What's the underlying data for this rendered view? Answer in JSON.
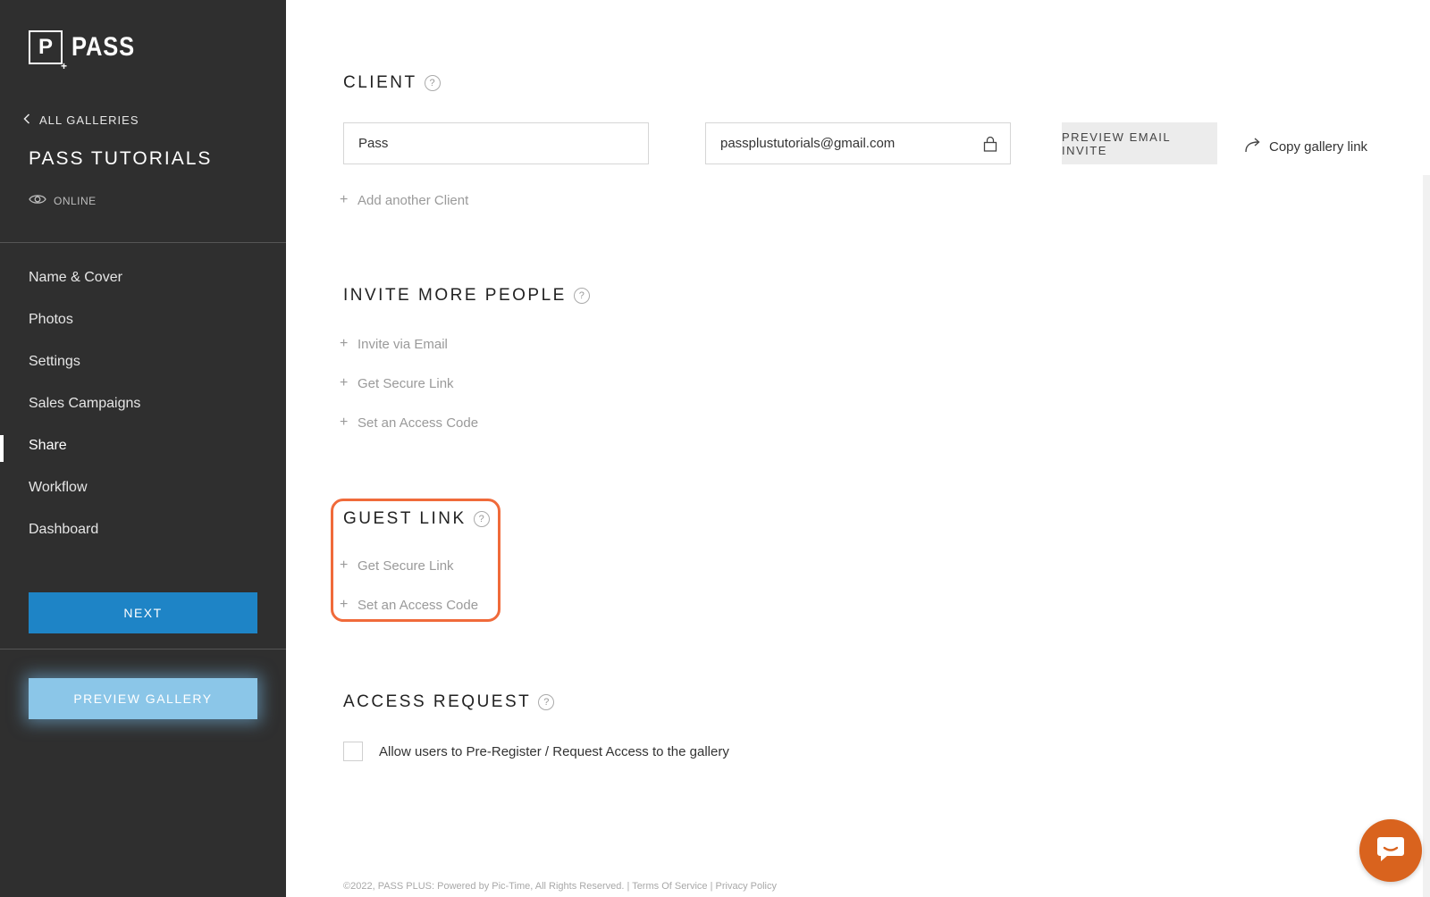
{
  "sidebar": {
    "logo_letter": "P",
    "logo_text": "PASS",
    "back_label": "ALL GALLERIES",
    "gallery_title": "PASS TUTORIALS",
    "status": "ONLINE",
    "nav": [
      {
        "label": "Name & Cover"
      },
      {
        "label": "Photos"
      },
      {
        "label": "Settings"
      },
      {
        "label": "Sales Campaigns"
      },
      {
        "label": "Share",
        "active": true
      },
      {
        "label": "Workflow"
      },
      {
        "label": "Dashboard"
      }
    ],
    "next_label": "NEXT",
    "preview_gallery_label": "PREVIEW GALLERY"
  },
  "client": {
    "title": "CLIENT",
    "name_value": "Pass",
    "email_value": "passplustutorials@gmail.com",
    "preview_email_label": "PREVIEW EMAIL INVITE",
    "copy_link_label": "Copy gallery link",
    "add_client_label": "Add another Client"
  },
  "invite": {
    "title": "INVITE MORE PEOPLE",
    "items": [
      "Invite via Email",
      "Get Secure Link",
      "Set an Access Code"
    ]
  },
  "guest": {
    "title": "GUEST LINK",
    "items": [
      "Get Secure Link",
      "Set an Access Code"
    ],
    "highlight_color": "#f06a3a"
  },
  "access": {
    "title": "ACCESS REQUEST",
    "checkbox_label": "Allow users to Pre-Register / Request Access to the gallery",
    "checked": false
  },
  "footer": {
    "copyright": "©2022, PASS PLUS: Powered by Pic-Time, All Rights Reserved.",
    "sep": "|",
    "terms": "Terms Of Service",
    "privacy": "Privacy Policy"
  },
  "help_symbol": "?",
  "colors": {
    "sidebar_bg": "#2f2f2f",
    "primary": "#1e84c6",
    "preview": "#8bc6e8",
    "chat": "#d9631e"
  }
}
